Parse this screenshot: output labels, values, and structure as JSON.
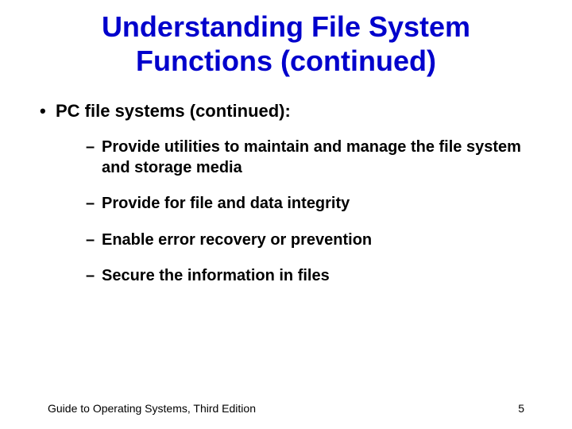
{
  "title": "Understanding File System Functions (continued)",
  "bullets": {
    "l1": "PC file systems (continued):",
    "l2": [
      "Provide utilities to maintain and manage the file system and storage media",
      "Provide for file and data integrity",
      "Enable error recovery or prevention",
      "Secure the information in files"
    ]
  },
  "footer": {
    "text": "Guide to Operating Systems, Third Edition",
    "page": "5"
  }
}
